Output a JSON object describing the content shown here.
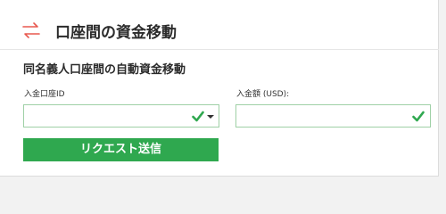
{
  "header": {
    "title": "口座間の資金移動",
    "icon": "transfer-arrows-icon"
  },
  "section": {
    "title": "同名義人口座間の自動資金移動"
  },
  "form": {
    "from_account": {
      "label": "入金口座ID",
      "value": "",
      "status_icon": "check-icon"
    },
    "amount": {
      "label": "入金額 (USD):",
      "value": "",
      "status_icon": "check-icon"
    },
    "submit_label": "リクエスト送信"
  },
  "colors": {
    "accent": "#2fa84f",
    "icon_accent": "#e8584f",
    "field_border": "#9fd0a6"
  }
}
